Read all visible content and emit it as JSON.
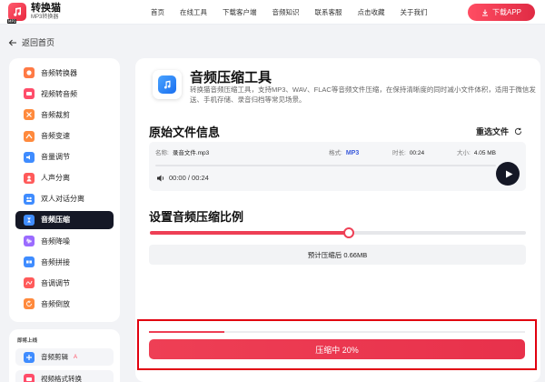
{
  "header": {
    "brand_name": "转换猫",
    "brand_sub": "MP3转换器",
    "logo_tag": "MP3",
    "nav": [
      "首页",
      "在线工具",
      "下载客户端",
      "音频知识",
      "联系客服",
      "点击收藏",
      "关于我们"
    ],
    "download_label": "下载APP"
  },
  "back_label": "返回首页",
  "sidebar": {
    "items": [
      {
        "label": "音频转换器",
        "color": "#ff7a45",
        "icon": "music-convert-icon"
      },
      {
        "label": "视频转音频",
        "color": "#ff4d6a",
        "icon": "video-to-audio-icon"
      },
      {
        "label": "音频裁剪",
        "color": "#ff8a3d",
        "icon": "scissors-icon"
      },
      {
        "label": "音频变速",
        "color": "#ff8a3d",
        "icon": "speed-icon"
      },
      {
        "label": "音量调节",
        "color": "#3f8cff",
        "icon": "volume-icon"
      },
      {
        "label": "人声分离",
        "color": "#ff5a5a",
        "icon": "vocal-separation-icon"
      },
      {
        "label": "双人对话分离",
        "color": "#3f8cff",
        "icon": "dialogue-icon"
      },
      {
        "label": "音频压缩",
        "color": "#3f8cff",
        "icon": "compress-icon"
      },
      {
        "label": "音频降噪",
        "color": "#9b6bff",
        "icon": "denoise-icon"
      },
      {
        "label": "音频拼接",
        "color": "#3f8cff",
        "icon": "merge-icon"
      },
      {
        "label": "音调调节",
        "color": "#ff5a5a",
        "icon": "pitch-icon"
      },
      {
        "label": "音频倒放",
        "color": "#ff8a3d",
        "icon": "reverse-icon"
      }
    ],
    "active_index": 7
  },
  "sidebar2": {
    "heading": "即将上线",
    "items": [
      {
        "label": "音频剪辑",
        "badge": "A"
      },
      {
        "label": "视频格式转换",
        "badge": ""
      }
    ]
  },
  "tool": {
    "title": "音频压缩工具",
    "desc": "转换猫音频压缩工具，支持MP3、WAV、FLAC等音频文件压缩，在保持清晰度的同时减小文件体积，适用于微信发送、手机存储、录音归档等常见场景。"
  },
  "original": {
    "section_title": "原始文件信息",
    "reselect_label": "重选文件",
    "name_label": "名称:",
    "name_value": "录音文件.mp3",
    "format_label": "格式:",
    "format_value": "MP3",
    "duration_label": "时长:",
    "duration_value": "00:24",
    "size_label": "大小:",
    "size_value": "4.05 MB",
    "time_display": "00:00 / 00:24",
    "playback_progress": 0
  },
  "ratio": {
    "section_title": "设置音频压缩比例",
    "value_fraction": 0.53,
    "estimate_text": "预计压缩后 0.66MB"
  },
  "compress": {
    "button_label": "压缩中 20%",
    "progress_fraction": 0.2
  },
  "colors": {
    "accent": "#ee3f55",
    "dark": "#151826",
    "highlight_border": "#e1000f"
  }
}
